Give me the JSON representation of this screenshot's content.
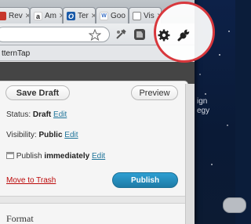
{
  "tabs": [
    {
      "label": "Rev",
      "icon": "red-favicon-icon",
      "color": "#c7362b"
    },
    {
      "label": "Am",
      "icon": "amazon-a-icon",
      "color": "#222222"
    },
    {
      "label": "Ter",
      "icon": "blue-site-icon",
      "color": "#1a5aa8"
    },
    {
      "label": "Goo",
      "icon": "google-w-icon",
      "color": "#ffffff"
    },
    {
      "label": "Vis",
      "icon": "page-icon",
      "color": "#ffffff"
    }
  ],
  "bookmarks_bar": {
    "item": "tternTap"
  },
  "publish": {
    "save_draft": "Save Draft",
    "preview": "Preview",
    "status_label": "Status:",
    "status_value": "Draft",
    "visibility_label": "Visibility:",
    "visibility_value": "Public",
    "publish_label": "Publish",
    "publish_value": "immediately",
    "edit": "Edit",
    "move_to_trash": "Move to Trash",
    "publish_button": "Publish"
  },
  "format": {
    "title": "Format"
  },
  "site_text": {
    "line1": "ign",
    "line2": "egy"
  },
  "colors": {
    "accent": "#21759b",
    "highlight": "#d8373c",
    "trash": "#bc0b0b",
    "publish_button": "#2a8fc2"
  }
}
